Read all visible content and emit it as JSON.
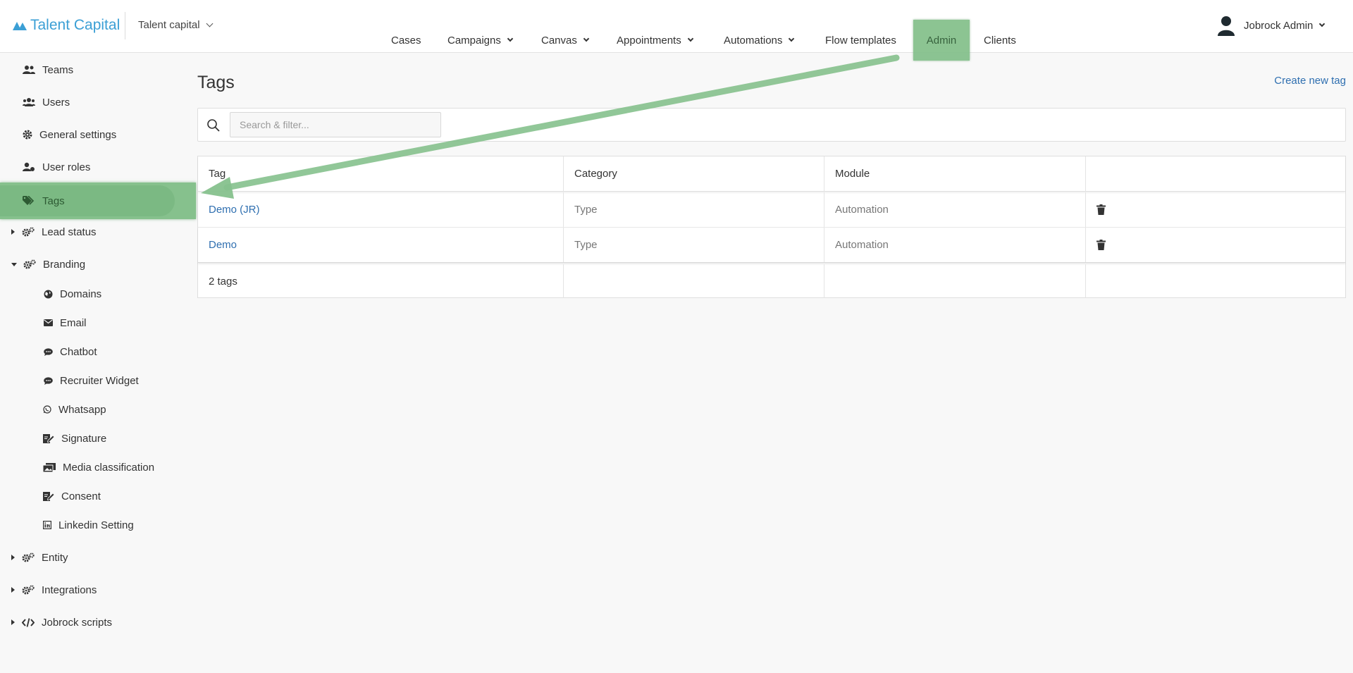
{
  "header": {
    "logo_text": "Talent Capital",
    "org_name": "Talent capital",
    "nav": [
      {
        "label": "Cases"
      },
      {
        "label": "Campaigns"
      },
      {
        "label": "Canvas"
      },
      {
        "label": "Appointments"
      },
      {
        "label": "Automations"
      },
      {
        "label": "Flow templates"
      },
      {
        "label": "Admin"
      },
      {
        "label": "Clients"
      }
    ],
    "user_name": "Jobrock Admin"
  },
  "sidebar": {
    "items": [
      {
        "label": "Teams",
        "icon": "users-icon"
      },
      {
        "label": "Users",
        "icon": "users-group-icon"
      },
      {
        "label": "General settings",
        "icon": "gear-icon"
      },
      {
        "label": "User roles",
        "icon": "user-role-icon"
      },
      {
        "label": "Tags",
        "icon": "tags-icon"
      },
      {
        "label": "Lead status",
        "icon": "gears-icon"
      },
      {
        "label": "Branding",
        "icon": "gears-icon"
      },
      {
        "label": "Domains",
        "icon": "globe-icon"
      },
      {
        "label": "Email",
        "icon": "envelope-icon"
      },
      {
        "label": "Chatbot",
        "icon": "chat-icon"
      },
      {
        "label": "Recruiter Widget",
        "icon": "chat-icon"
      },
      {
        "label": "Whatsapp",
        "icon": "whatsapp-icon"
      },
      {
        "label": "Signature",
        "icon": "signature-icon"
      },
      {
        "label": "Media classification",
        "icon": "media-icon"
      },
      {
        "label": "Consent",
        "icon": "signature-icon"
      },
      {
        "label": "Linkedin Setting",
        "icon": "linkedin-icon"
      },
      {
        "label": "Entity",
        "icon": "gears-icon"
      },
      {
        "label": "Integrations",
        "icon": "gears-icon"
      },
      {
        "label": "Jobrock scripts",
        "icon": "code-icon"
      }
    ]
  },
  "main": {
    "title": "Tags",
    "create_link": "Create new tag",
    "search_placeholder": "Search & filter...",
    "table": {
      "columns": [
        "Tag",
        "Category",
        "Module",
        ""
      ],
      "rows": [
        {
          "tag": "Demo (JR)",
          "category": "Type",
          "module": "Automation"
        },
        {
          "tag": "Demo",
          "category": "Type",
          "module": "Automation"
        }
      ],
      "footer": "2 tags"
    }
  },
  "colors": {
    "brand": "#3b9fd5",
    "link": "#2f6fb0",
    "highlight": "#86c18d"
  }
}
